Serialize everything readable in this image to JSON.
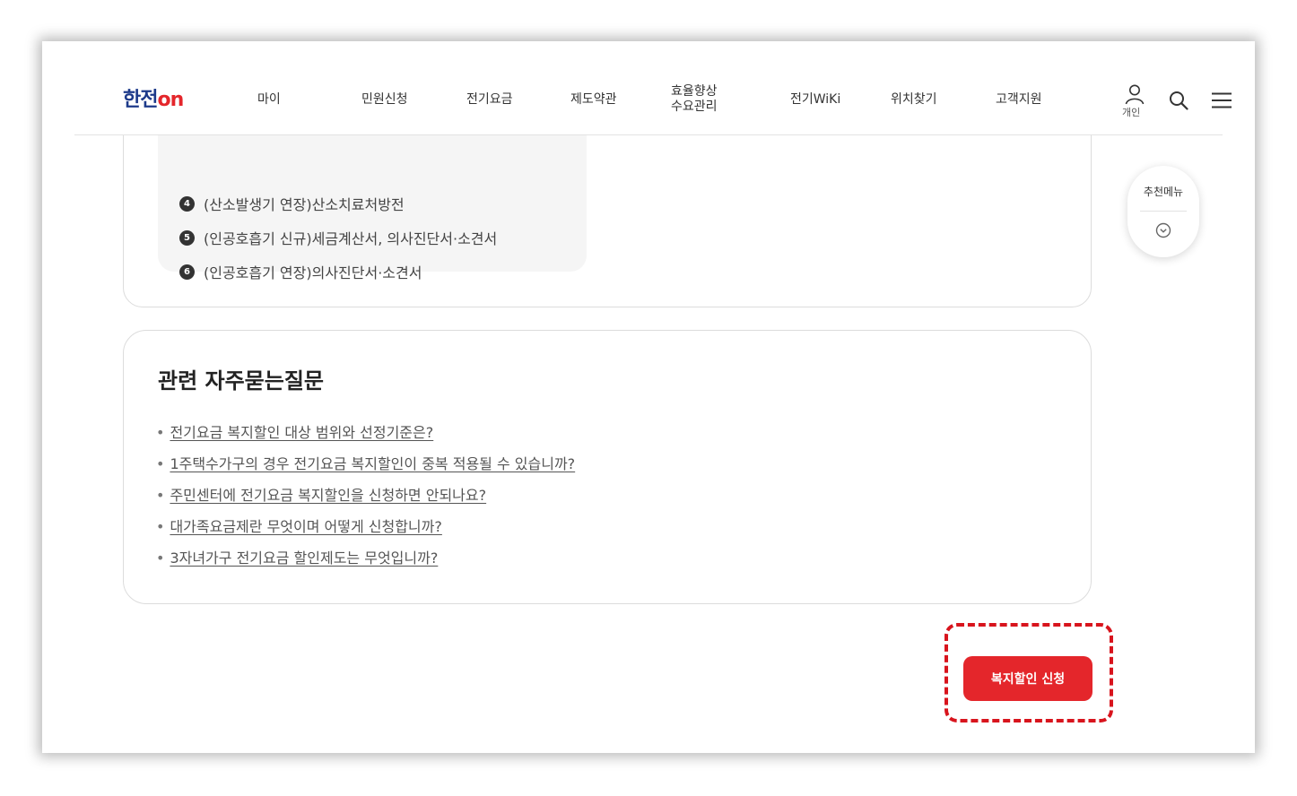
{
  "header": {
    "logo_prefix": "한전",
    "logo_suffix": "on",
    "nav": [
      "마이",
      "민원신청",
      "전기요금",
      "제도약관",
      "효율향상",
      "수요관리",
      "전기WiKi",
      "위치찾기",
      "고객지원"
    ],
    "user_label": "개인"
  },
  "documents": {
    "items": [
      {
        "num": "4",
        "text": "(산소발생기 연장)산소치료처방전"
      },
      {
        "num": "5",
        "text": "(인공호흡기 신규)세금계산서, 의사진단서·소견서"
      },
      {
        "num": "6",
        "text": "(인공호흡기 연장)의사진단서·소견서"
      }
    ]
  },
  "faq": {
    "title": "관련 자주묻는질문",
    "bullet": "•",
    "items": [
      "전기요금 복지할인 대상 범위와 선정기준은?",
      "1주택수가구의 경우 전기요금 복지할인이 중복 적용될 수 있습니까?",
      "주민센터에 전기요금 복지할인을 신청하면 안되나요?",
      "대가족요금제란 무엇이며 어떻게 신청합니까?",
      "3자녀가구 전기요금 할인제도는 무엇입니까?"
    ]
  },
  "recommend": {
    "label": "추천메뉴"
  },
  "apply_button": {
    "label": "복지할인 신청"
  },
  "colors": {
    "brand_blue": "#1d3a8a",
    "brand_red": "#e4262b",
    "highlight": "#d8141d"
  },
  "icons": [
    "user-icon",
    "search-icon",
    "hamburger-menu-icon",
    "chevron-down-circle-icon"
  ]
}
